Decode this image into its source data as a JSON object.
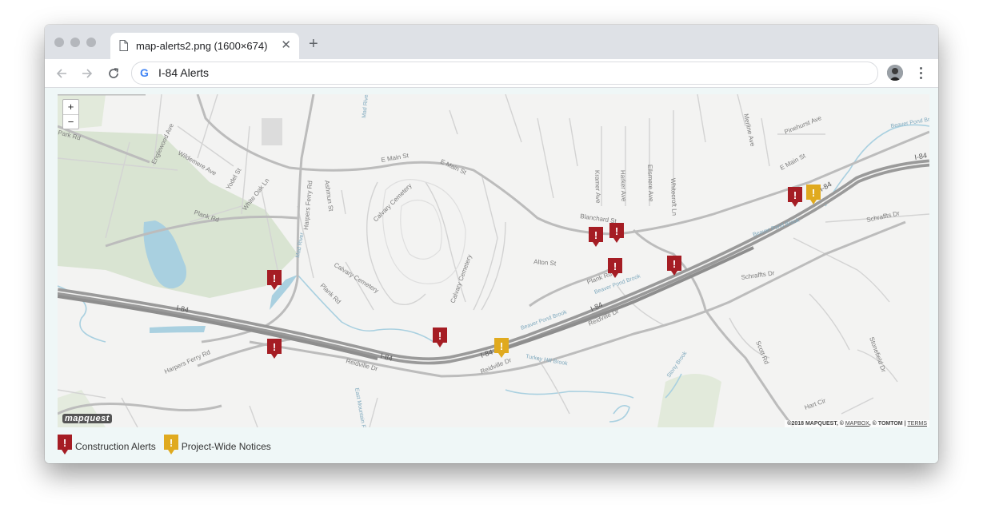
{
  "browser": {
    "tab_title": "map-alerts2.png (1600×674)",
    "tab_close_icon": "close-icon",
    "new_tab_icon": "plus-icon",
    "back_icon": "arrow-left-icon",
    "forward_icon": "arrow-right-icon",
    "reload_icon": "reload-icon",
    "search_engine_icon": "google-icon",
    "address_value": "I-84 Alerts",
    "menu_icon": "kebab-menu-icon"
  },
  "map": {
    "zoom_in": "+",
    "zoom_out": "−",
    "logo": "mapquest",
    "attribution": {
      "copyright": "©2018 MAPQUEST, © ",
      "mapbox": "MAPBOX",
      "tomtom": ", © TOMTOM | ",
      "terms": "TERMS"
    },
    "street_labels": {
      "e_main_st_1": "E Main St",
      "e_main_st_2": "E Main St",
      "e_main_st_3": "E Main St",
      "harpers_ferry_rd_1": "Harpers Ferry Rd",
      "harpers_ferry_rd_2": "Harpers Ferry Rd",
      "plank_rd_1": "Plank Rd",
      "plank_rd_2": "Plank Rd",
      "plank_rd_3": "Plank Rd",
      "reidville_dr_1": "Reidville Dr",
      "reidville_dr_2": "Reidville Dr",
      "reidville_dr_3": "Reidville Dr",
      "i84_1": "I-84",
      "i84_2": "I-84",
      "i84_3": "I-84",
      "i84_4": "I-84",
      "i84_5": "I-84",
      "i84_6": "I-84",
      "calvary_cemetery_1": "Calvary Cemetery",
      "calvary_cemetery_2": "Calvary Cemetery",
      "calvary_cemetery_3": "Calvary Cemetery",
      "ashmun_st": "Ashmun St",
      "englewood_ave": "Englewood Ave",
      "wildemere_ave": "Wildemere Ave",
      "white_oak_ln": "White Oak Ln",
      "yodel_st": "Yodel St",
      "blanchard_st": "Blanchard St",
      "alton_st": "Alton St",
      "kramer_ave": "Kramer Ave",
      "harker_ave": "Harker Ave",
      "ellsmere_ave": "Ellsmere Ave",
      "whitecroft_ln": "Whitecroft Ln",
      "merline_ave": "Merline Ave",
      "pinehurst_ave": "Pinehurst Ave",
      "beaver_pond_brook_1": "Beaver Pond Brook",
      "beaver_pond_brook_2": "Beaver Pond Brook",
      "beaver_pond_brook_3": "Beaver Pond Brook",
      "beaver_pond_brook_4": "Beaver Pond Brook",
      "schraffts_dr_1": "Schraffts Dr",
      "schraffts_dr_2": "Schraffts Dr",
      "scott_rd": "Scott Rd",
      "hart_cir": "Hart Cir",
      "stonefield_dr": "Stonefield Dr",
      "turkey_hill_brook": "Turkey Hill Brook",
      "stony_brook": "Stony Brook",
      "mad_river_rd": "Mad River Rd",
      "east_mountain_rd": "East Mountain Rd",
      "mad_river": "Mad River",
      "park_rd": "Park Rd"
    }
  },
  "alerts": [
    {
      "type": "construction",
      "symbol": "!"
    },
    {
      "type": "construction",
      "symbol": "!"
    },
    {
      "type": "construction",
      "symbol": "!"
    },
    {
      "type": "construction",
      "symbol": "!"
    },
    {
      "type": "construction",
      "symbol": "!"
    },
    {
      "type": "construction",
      "symbol": "!"
    },
    {
      "type": "construction",
      "symbol": "!"
    },
    {
      "type": "construction",
      "symbol": "!"
    },
    {
      "type": "project",
      "symbol": "!"
    },
    {
      "type": "project",
      "symbol": "!"
    }
  ],
  "legend": {
    "construction_label": "Construction Alerts",
    "project_label": "Project-Wide Notices"
  },
  "colors": {
    "construction_marker": "#a51d24",
    "project_marker": "#e0aa1f",
    "highway": "#8e8e8e",
    "water": "#a9d0e0",
    "park": "#d9e4d2",
    "map_background": "#f3f3f2",
    "panel_background": "#eff7f7"
  }
}
